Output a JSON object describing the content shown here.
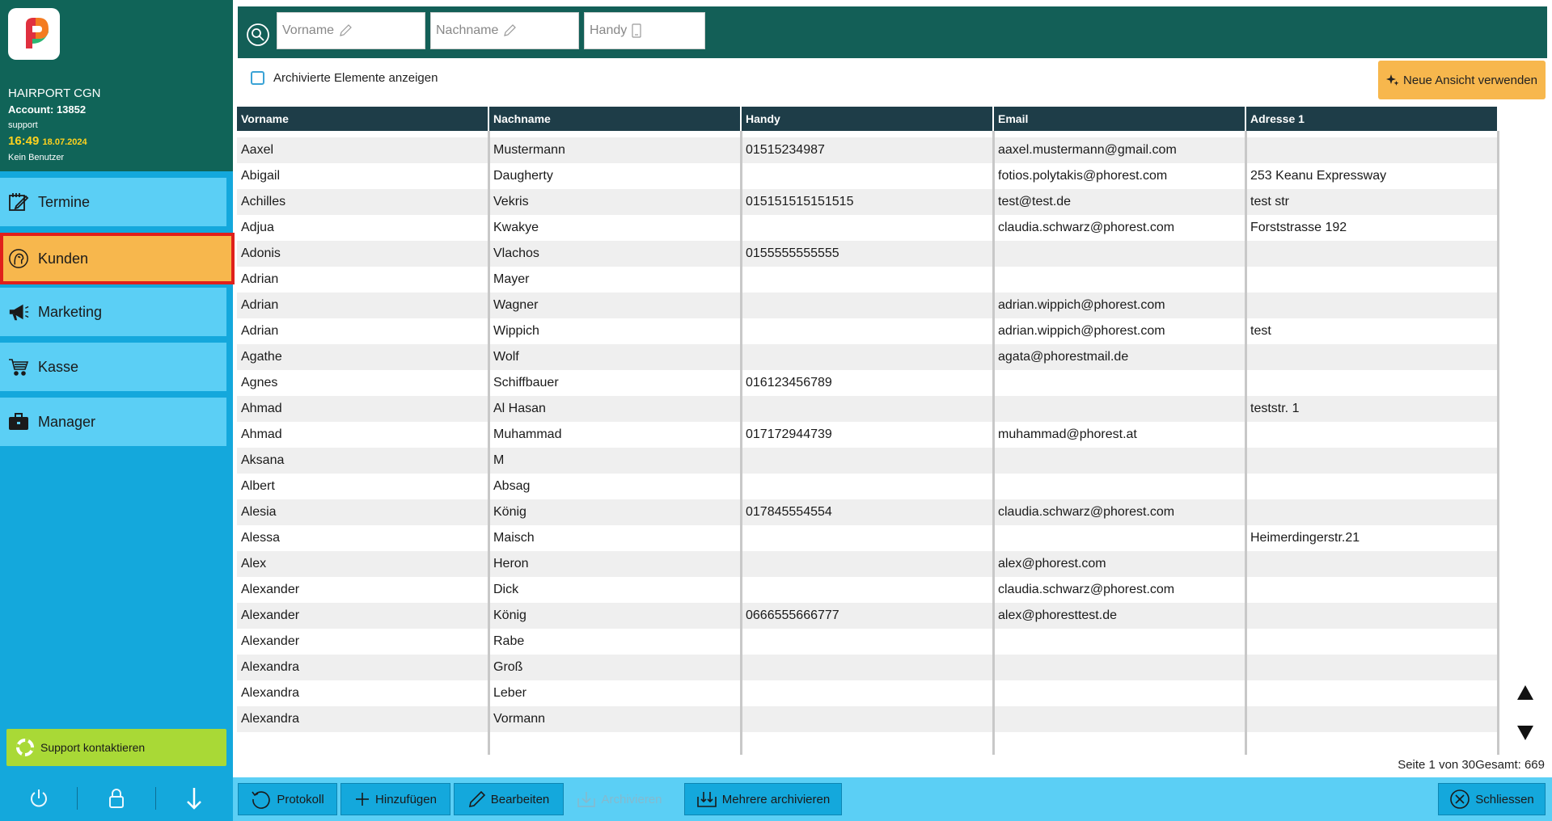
{
  "sidebar": {
    "salon": "HAIRPORT CGN",
    "account": "Account: 13852",
    "user": "support",
    "time": "16:49",
    "date": "18.07.2024",
    "no_user": "Kein Benutzer",
    "nav": [
      {
        "label": "Termine",
        "icon": "calendar-edit-icon"
      },
      {
        "label": "Kunden",
        "icon": "customer-head-icon",
        "selected": true
      },
      {
        "label": "Marketing",
        "icon": "megaphone-icon"
      },
      {
        "label": "Kasse",
        "icon": "cart-icon"
      },
      {
        "label": "Manager",
        "icon": "briefcase-icon"
      }
    ],
    "support_label": "Support kontaktieren",
    "bottom_icons": [
      "power-icon",
      "lock-icon",
      "arrow-down-icon"
    ]
  },
  "search": {
    "vorname_placeholder": "Vorname",
    "nachname_placeholder": "Nachname",
    "handy_placeholder": "Handy"
  },
  "filters": {
    "archived_label": "Archivierte Elemente anzeigen",
    "archived_checked": false
  },
  "new_view_label": "Neue Ansicht verwenden",
  "table": {
    "columns": [
      "Vorname",
      "Nachname",
      "Handy",
      "Email",
      "Adresse 1"
    ],
    "rows": [
      [
        "Aaxel",
        "Mustermann",
        "01515234987",
        "aaxel.mustermann@gmail.com",
        ""
      ],
      [
        "Abigail",
        "Daugherty",
        "",
        "fotios.polytakis@phorest.com",
        "253 Keanu Expressway"
      ],
      [
        "Achilles",
        "Vekris",
        "015151515151515",
        "test@test.de",
        "test str"
      ],
      [
        "Adjua",
        "Kwakye",
        "",
        "claudia.schwarz@phorest.com",
        "Forststrasse 192"
      ],
      [
        "Adonis",
        "Vlachos",
        "0155555555555",
        "",
        ""
      ],
      [
        "Adrian",
        "Mayer",
        "",
        "",
        ""
      ],
      [
        "Adrian",
        "Wagner",
        "",
        "adrian.wippich@phorest.com",
        ""
      ],
      [
        "Adrian",
        "Wippich",
        "",
        "adrian.wippich@phorest.com",
        "test"
      ],
      [
        "Agathe",
        "Wolf",
        "",
        "agata@phorestmail.de",
        ""
      ],
      [
        "Agnes",
        "Schiffbauer",
        "016123456789",
        "",
        ""
      ],
      [
        "Ahmad",
        "Al Hasan",
        "",
        "",
        "teststr. 1"
      ],
      [
        "Ahmad",
        "Muhammad",
        "017172944739",
        "muhammad@phorest.at",
        ""
      ],
      [
        "Aksana",
        "M",
        "",
        "",
        ""
      ],
      [
        "Albert",
        "Absag",
        "",
        "",
        ""
      ],
      [
        "Alesia",
        "König",
        "017845554554",
        "claudia.schwarz@phorest.com",
        ""
      ],
      [
        "Alessa",
        "Maisch",
        "",
        "",
        "Heimerdingerstr.21"
      ],
      [
        "Alex",
        "Heron",
        "",
        "alex@phorest.com",
        ""
      ],
      [
        "Alexander",
        "Dick",
        "",
        "claudia.schwarz@phorest.com",
        ""
      ],
      [
        "Alexander",
        "König",
        "0666555666777",
        "alex@phoresttest.de",
        ""
      ],
      [
        "Alexander",
        "Rabe",
        "",
        "",
        ""
      ],
      [
        "Alexandra",
        "Groß",
        "",
        "",
        ""
      ],
      [
        "Alexandra",
        "Leber",
        "",
        "",
        ""
      ],
      [
        "Alexandra",
        "Vormann",
        "",
        "",
        ""
      ]
    ]
  },
  "pagination": {
    "page_text": "Seite 1 von 30",
    "total_text": "Gesamt: 669"
  },
  "toolbar": {
    "protokoll": "Protokoll",
    "hinzufuegen": "Hinzufügen",
    "bearbeiten": "Bearbeiten",
    "archivieren": "Archivieren",
    "mehrere_archivieren": "Mehrere archivieren",
    "schliessen": "Schliessen"
  },
  "colors": {
    "sidebar": "#14a8dc",
    "sidebar_head": "#106458",
    "nav_button": "#5bcff5",
    "nav_selected": "#f7b74d",
    "selected_border": "#e0201b",
    "search_bar": "#135f57",
    "table_header": "#1e3d48",
    "support": "#a9d936",
    "time": "#ffd21e"
  }
}
